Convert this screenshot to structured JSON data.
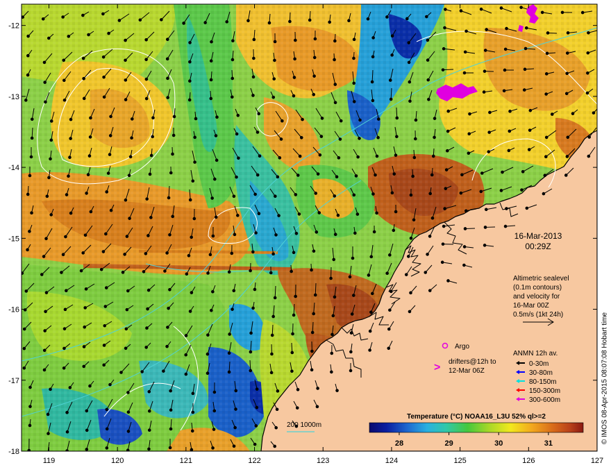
{
  "map": {
    "lon_ticks": [
      "119",
      "120",
      "121",
      "122",
      "123",
      "124",
      "125",
      "126",
      "127"
    ],
    "lat_ticks": [
      "-12",
      "-13",
      "-14",
      "-15",
      "-16",
      "-17",
      "-18"
    ],
    "extent": {
      "lon": [
        118.6,
        127
      ],
      "lat": [
        -18,
        -11.7
      ]
    },
    "colors": {
      "land": "#f7c8a0",
      "coast": "#000000",
      "contour": "#ffffff",
      "isobath": "#4fd2d6"
    }
  },
  "date": {
    "day": "16-Mar-2013",
    "time": "00:29Z"
  },
  "altimetry": {
    "line1": "Altimetric sealevel",
    "line2": "(0.1m contours)",
    "line3": "and velocity for",
    "line4": "16-Mar 00Z",
    "line5": "0.5m/s (1kt 24h)"
  },
  "argo": {
    "label": "Argo",
    "color": "#e000e0"
  },
  "drifters": {
    "line1": "drifters@12h to",
    "line2": "12-Mar 06Z",
    "symbol": ">",
    "color": "#e000e0"
  },
  "anmn": {
    "title": "ANMN 12h av.",
    "items": [
      {
        "label": "0-30m",
        "color": "#000000"
      },
      {
        "label": "30-80m",
        "color": "#0000ff"
      },
      {
        "label": "80-150m",
        "color": "#00e0e0"
      },
      {
        "label": "150-300m",
        "color": "#ff0000"
      },
      {
        "label": "300-600m",
        "color": "#e000e0"
      }
    ]
  },
  "colorbar": {
    "title": "Temperature (°C) NOAA16_L3U 52% ql>=2",
    "ticks": [
      "28",
      "29",
      "30",
      "31"
    ],
    "range": [
      27.4,
      31.7
    ]
  },
  "isobath_legend": {
    "label": "200  1000m"
  },
  "credit": "© IMOS 08-Apr-2015 08:07:08 Hobart time"
}
